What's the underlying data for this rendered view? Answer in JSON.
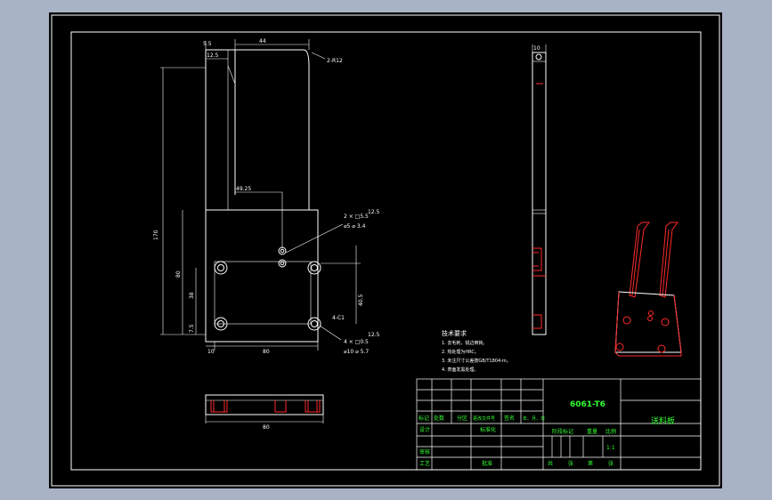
{
  "top_view": {
    "dim_w1": "5.5",
    "dim_w2": "44",
    "dim_w3": "12.5",
    "dim_radius": "2-R12",
    "dim_height": "170",
    "dim_sub": "49.25",
    "dim_left_80": "80",
    "dim_left_38": "38",
    "dim_left_75": "7.5",
    "dim_bottom_10": "10",
    "dim_bottom_80": "80",
    "dim_right": "40.5",
    "chamfer": "4-C1"
  },
  "callouts": {
    "hole_a_qty": "2 × □5.5",
    "hole_a_spec": "⌀5 ⌀ 3.4",
    "rough_a": "12.5",
    "hole_b_qty": "4 × □0.5",
    "hole_b_spec": "⌀10 ⌀ 5.7",
    "rough_b": "12.5"
  },
  "side_view": {
    "dim_top": "10"
  },
  "front_view": {
    "dim_bottom": "80"
  },
  "notes": {
    "title": "技术要求",
    "lines": [
      "1. 去毛刺，锐边倒钝。",
      "2. 热处理为HRC。",
      "3. 未注尺寸公差按GB/T1804-m。",
      "4. 表面发黑处理。"
    ]
  },
  "title_block": {
    "material": "6061-T6",
    "part_name": "送料板",
    "row_labels": [
      "标记",
      "处数",
      "分区",
      "更改文件号",
      "签名",
      "年、月、日"
    ],
    "design": "设计",
    "standard": "标准化",
    "review": "审核",
    "process": "工艺",
    "approve": "批准",
    "stage_mark": "阶段标记",
    "weight": "重量",
    "scale_label": "比例",
    "scale": "1:1",
    "sheets_total": "共",
    "sheets_label": "张",
    "sheet_no": "第",
    "sheet_label": "张"
  }
}
